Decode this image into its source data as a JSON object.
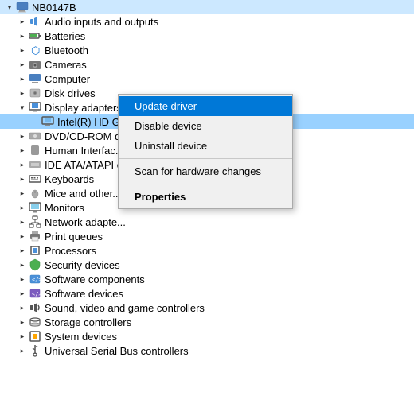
{
  "tree": {
    "root": {
      "label": "NB0147B",
      "chevron": "expanded",
      "indent": 0
    },
    "items": [
      {
        "id": "audio",
        "label": "Audio inputs and outputs",
        "chevron": "collapsed",
        "indent": 1,
        "icon": "audio"
      },
      {
        "id": "batteries",
        "label": "Batteries",
        "chevron": "collapsed",
        "indent": 1,
        "icon": "battery"
      },
      {
        "id": "bluetooth",
        "label": "Bluetooth",
        "chevron": "collapsed",
        "indent": 1,
        "icon": "bluetooth"
      },
      {
        "id": "cameras",
        "label": "Cameras",
        "chevron": "collapsed",
        "indent": 1,
        "icon": "camera"
      },
      {
        "id": "computer",
        "label": "Computer",
        "chevron": "collapsed",
        "indent": 1,
        "icon": "computer"
      },
      {
        "id": "disk",
        "label": "Disk drives",
        "chevron": "collapsed",
        "indent": 1,
        "icon": "disk"
      },
      {
        "id": "display",
        "label": "Display adapters",
        "chevron": "expanded",
        "indent": 1,
        "icon": "display"
      },
      {
        "id": "intel",
        "label": "Intel(R) HD Graphics 620",
        "chevron": "none",
        "indent": 2,
        "icon": "display-item",
        "selected": true
      },
      {
        "id": "dvd",
        "label": "DVD/CD-ROM d...",
        "chevron": "collapsed",
        "indent": 1,
        "icon": "dvd"
      },
      {
        "id": "human",
        "label": "Human Interfac...",
        "chevron": "collapsed",
        "indent": 1,
        "icon": "hid"
      },
      {
        "id": "ide",
        "label": "IDE ATA/ATAPI c...",
        "chevron": "collapsed",
        "indent": 1,
        "icon": "ide"
      },
      {
        "id": "keyboards",
        "label": "Keyboards",
        "chevron": "collapsed",
        "indent": 1,
        "icon": "keyboard"
      },
      {
        "id": "mice",
        "label": "Mice and other...",
        "chevron": "collapsed",
        "indent": 1,
        "icon": "mouse"
      },
      {
        "id": "monitors",
        "label": "Monitors",
        "chevron": "collapsed",
        "indent": 1,
        "icon": "monitor"
      },
      {
        "id": "network",
        "label": "Network adapte...",
        "chevron": "collapsed",
        "indent": 1,
        "icon": "network"
      },
      {
        "id": "print",
        "label": "Print queues",
        "chevron": "collapsed",
        "indent": 1,
        "icon": "printer"
      },
      {
        "id": "processors",
        "label": "Processors",
        "chevron": "collapsed",
        "indent": 1,
        "icon": "processor"
      },
      {
        "id": "security",
        "label": "Security devices",
        "chevron": "collapsed",
        "indent": 1,
        "icon": "security"
      },
      {
        "id": "software-comp",
        "label": "Software components",
        "chevron": "collapsed",
        "indent": 1,
        "icon": "software"
      },
      {
        "id": "software-dev",
        "label": "Software devices",
        "chevron": "collapsed",
        "indent": 1,
        "icon": "software2"
      },
      {
        "id": "sound",
        "label": "Sound, video and game controllers",
        "chevron": "collapsed",
        "indent": 1,
        "icon": "sound"
      },
      {
        "id": "storage",
        "label": "Storage controllers",
        "chevron": "collapsed",
        "indent": 1,
        "icon": "storage"
      },
      {
        "id": "system",
        "label": "System devices",
        "chevron": "collapsed",
        "indent": 1,
        "icon": "system"
      },
      {
        "id": "usb",
        "label": "Universal Serial Bus controllers",
        "chevron": "collapsed",
        "indent": 1,
        "icon": "usb"
      }
    ]
  },
  "context_menu": {
    "items": [
      {
        "id": "update-driver",
        "label": "Update driver",
        "bold": false,
        "active": true
      },
      {
        "id": "disable-device",
        "label": "Disable device",
        "bold": false
      },
      {
        "id": "uninstall-device",
        "label": "Uninstall device",
        "bold": false
      },
      {
        "id": "separator",
        "type": "separator"
      },
      {
        "id": "scan-hardware",
        "label": "Scan for hardware changes",
        "bold": false
      },
      {
        "id": "separator2",
        "type": "separator"
      },
      {
        "id": "properties",
        "label": "Properties",
        "bold": true
      }
    ]
  }
}
